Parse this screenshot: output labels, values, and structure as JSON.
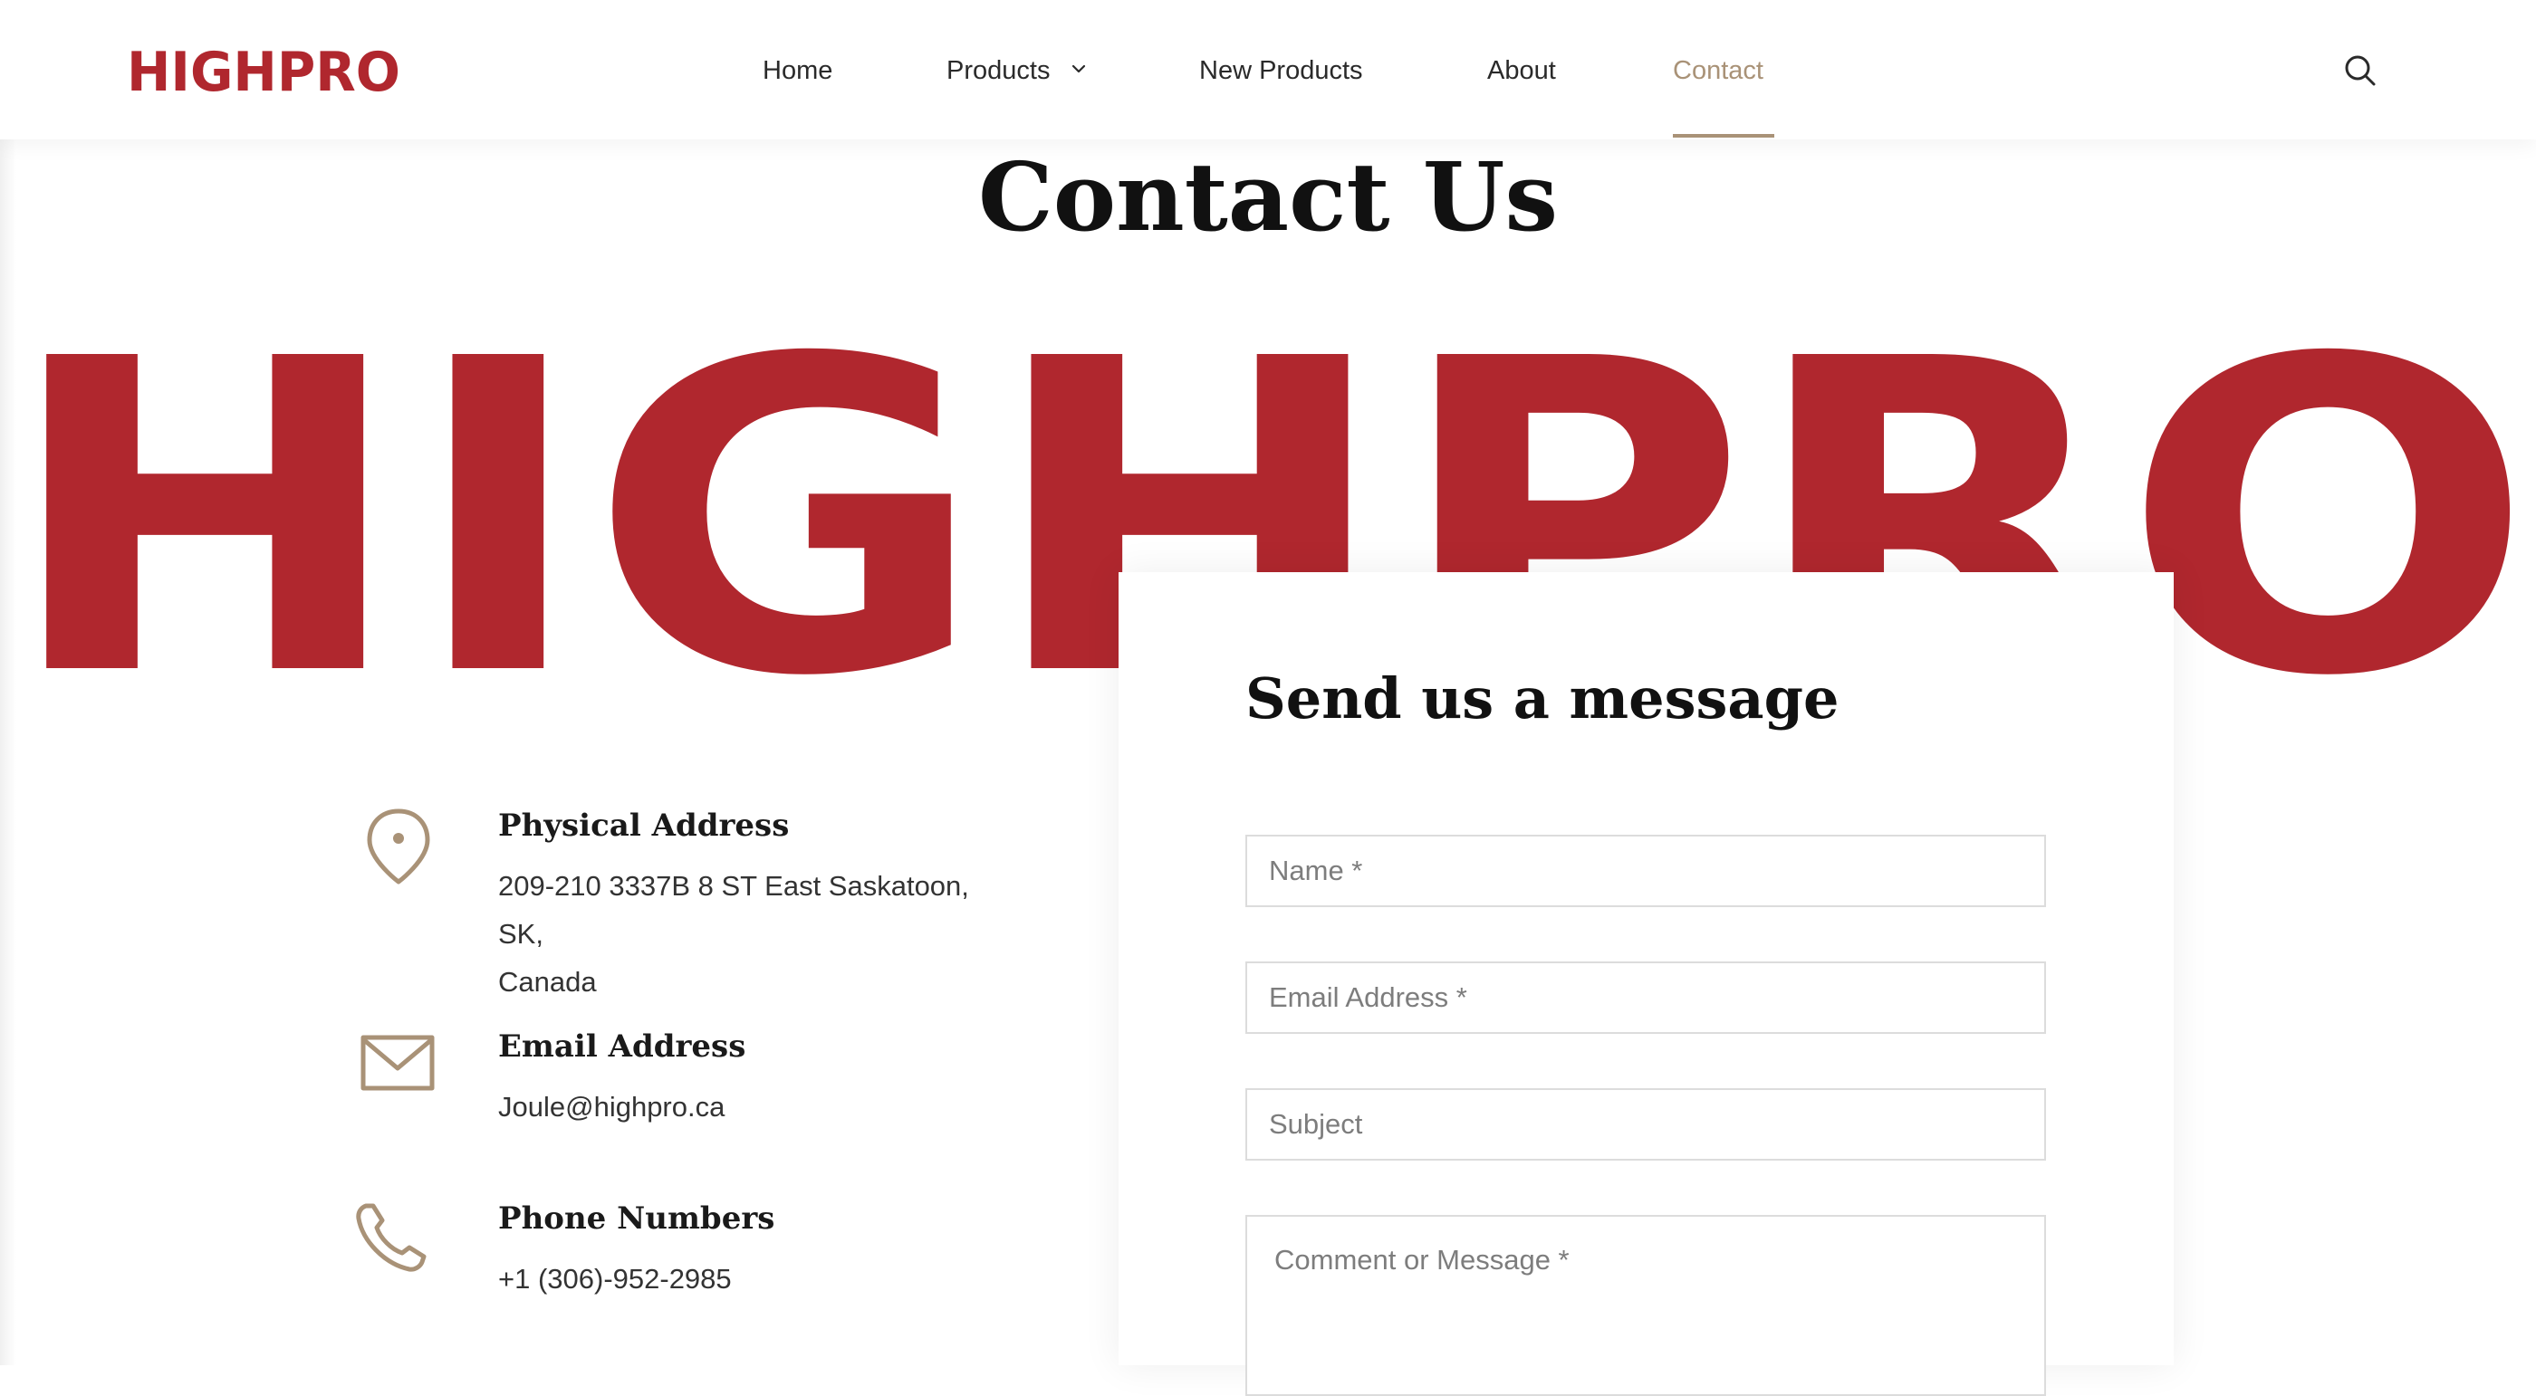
{
  "brand": {
    "name": "HIGHPRO",
    "logo_color": "#b0272e",
    "accent_color": "#a99277"
  },
  "nav": {
    "items": [
      {
        "label": "Home"
      },
      {
        "label": "Products",
        "has_dropdown": true
      },
      {
        "label": "New Products"
      },
      {
        "label": "About"
      },
      {
        "label": "Contact",
        "active": true
      }
    ],
    "search_icon": "search-icon"
  },
  "page": {
    "title": "Contact Us"
  },
  "contact": {
    "address": {
      "heading": "Physical Address",
      "line1": "209-210 3337B 8 ST East Saskatoon, SK,",
      "line2": "Canada",
      "icon": "map-pin-icon"
    },
    "email": {
      "heading": "Email Address",
      "value": "Joule@highpro.ca",
      "icon": "envelope-icon"
    },
    "phone": {
      "heading": "Phone Numbers",
      "value": "+1 (306)-952-2985",
      "icon": "phone-icon"
    }
  },
  "form": {
    "title": "Send us a message",
    "name_placeholder": "Name *",
    "email_placeholder": "Email Address *",
    "subject_placeholder": "Subject",
    "message_placeholder": "Comment or Message *"
  }
}
